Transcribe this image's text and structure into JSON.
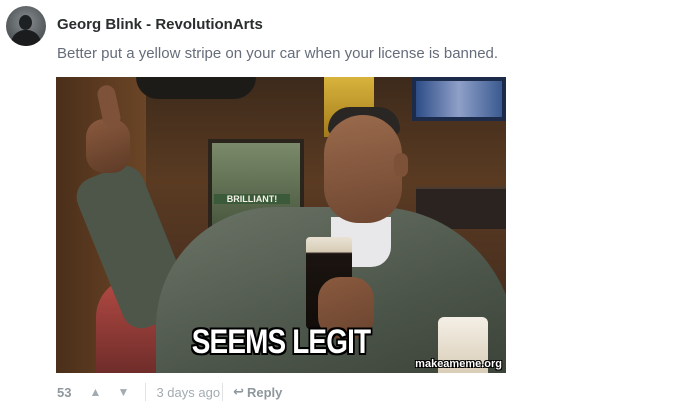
{
  "comment": {
    "author": "Georg Blink - RevolutionArts",
    "message": "Better put a yellow stripe on your car when your license is banned.",
    "avatar_icon": "user-avatar",
    "image": {
      "caption": "SEEMS LEGIT",
      "watermark": "makeameme.org",
      "poster_text": "BRILLIANT!"
    },
    "footer": {
      "votes": "53",
      "upvote_icon": "▲",
      "downvote_icon": "▼",
      "time": "3 days ago",
      "reply_icon": "↩",
      "reply_label": "Reply"
    }
  }
}
